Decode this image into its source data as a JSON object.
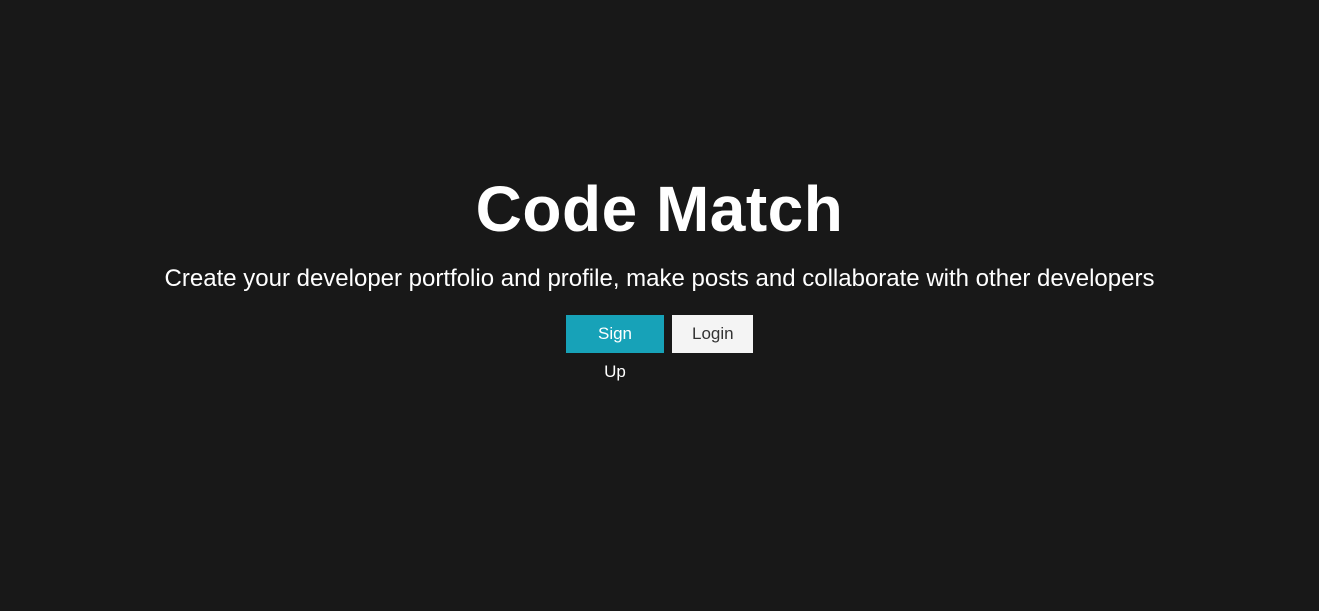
{
  "hero": {
    "title": "Code Match",
    "tagline": "Create your developer portfolio and profile, make posts and collaborate with other developers"
  },
  "buttons": {
    "signup_label": "Sign Up",
    "login_label": "Login"
  },
  "colors": {
    "background": "#181818",
    "primary": "#17a2b8",
    "light": "#f4f4f4",
    "text": "#ffffff"
  }
}
